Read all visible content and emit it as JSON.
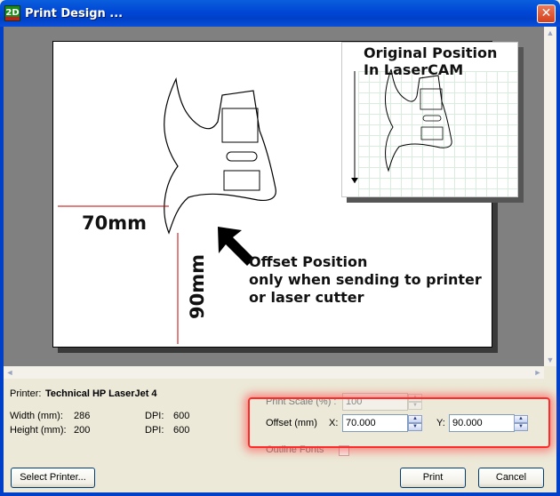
{
  "window": {
    "title": "Print Design ...",
    "app_icon_text": "2D",
    "close_glyph": "✕"
  },
  "preview": {
    "inset_label_line1": "Original Position",
    "inset_label_line2": "In LaserCAM",
    "dim_horizontal": "70mm",
    "dim_vertical": "90mm",
    "note_line1": "Offset Position",
    "note_line2": "only when sending to printer",
    "note_line3": "or laser cutter"
  },
  "scrollbars": {
    "up": "▲",
    "down": "▼",
    "left": "◄",
    "right": "►"
  },
  "printer_info": {
    "printer_label": "Printer:",
    "printer_name": "Technical HP LaserJet 4",
    "width_label": "Width (mm):",
    "width_value": "286",
    "height_label": "Height (mm):",
    "height_value": "200",
    "dpi_label_1": "DPI:",
    "dpi_value_1": "600",
    "dpi_label_2": "DPI:",
    "dpi_value_2": "600"
  },
  "settings": {
    "print_scale_label": "Print Scale (%) :",
    "print_scale_value": "100",
    "offset_label": "Offset (mm)",
    "x_label": "X:",
    "x_value": "70.000",
    "y_label": "Y:",
    "y_value": "90.000",
    "outline_fonts_label": "Outline Fonts",
    "spin_up": "▲",
    "spin_down": "▼"
  },
  "buttons": {
    "select_printer": "Select Printer...",
    "print": "Print",
    "cancel": "Cancel"
  },
  "colors": {
    "title_bar": "#0046d5",
    "highlight": "#ff2a2a",
    "preview_bg": "#808080"
  }
}
